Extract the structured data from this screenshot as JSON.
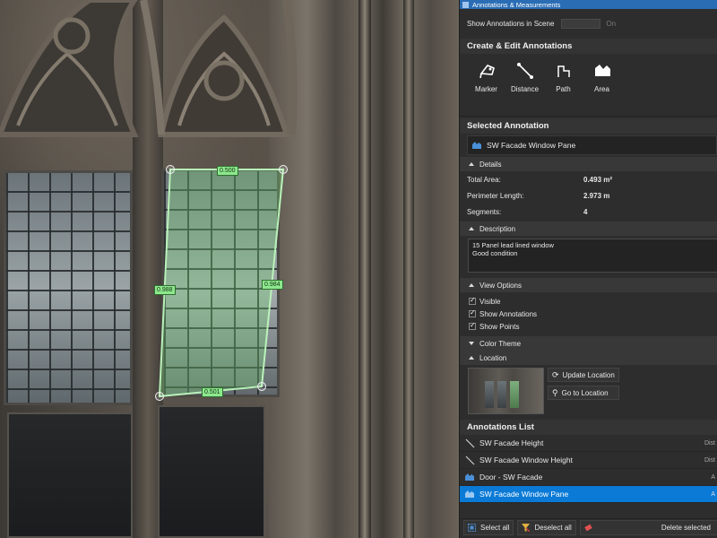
{
  "viewport": {
    "measurements": {
      "top": "0.500",
      "left": "0.988",
      "right": "0.984",
      "bottom": "0.501"
    }
  },
  "panel": {
    "title": "Annotations & Measurements",
    "show_annotations_label": "Show Annotations in Scene",
    "show_annotations_state": "On",
    "create_heading": "Create & Edit Annotations",
    "tools": [
      {
        "label": "Marker",
        "icon": "marker-icon"
      },
      {
        "label": "Distance",
        "icon": "distance-icon"
      },
      {
        "label": "Path",
        "icon": "path-icon"
      },
      {
        "label": "Area",
        "icon": "area-icon"
      }
    ],
    "selected_heading": "Selected Annotation",
    "selected_name": "SW Facade Window Pane",
    "details_heading": "Details",
    "details": {
      "total_area_label": "Total Area:",
      "total_area_value": "0.493 m²",
      "perimeter_label": "Perimeter Length:",
      "perimeter_value": "2.973 m",
      "segments_label": "Segments:",
      "segments_value": "4"
    },
    "description_heading": "Description",
    "description_text": "15 Panel lead lined window\nGood condition",
    "view_options_heading": "View Options",
    "view_options": [
      "Visible",
      "Show Annotations",
      "Show Points"
    ],
    "color_theme_heading": "Color Theme",
    "location_heading": "Location",
    "update_location_label": "Update Location",
    "go_to_location_label": "Go to Location",
    "list_heading": "Annotations List",
    "list_items": [
      {
        "label": "SW Facade Height",
        "tag": "Dist",
        "icon": "distance-icon"
      },
      {
        "label": "SW Facade Window Height",
        "tag": "Dist",
        "icon": "distance-icon"
      },
      {
        "label": "Door - SW Facade",
        "tag": "A",
        "icon": "area-icon"
      },
      {
        "label": "SW Facade Window Pane",
        "tag": "A",
        "icon": "area-icon"
      }
    ],
    "footer": {
      "select_all": "Select all",
      "deselect_all": "Deselect all",
      "delete_selected": "Delete selected"
    }
  },
  "colors": {
    "selection_blue": "#0a7ad6",
    "titlebar_blue": "#2a6db5",
    "measure_green": "#8ee88e"
  }
}
